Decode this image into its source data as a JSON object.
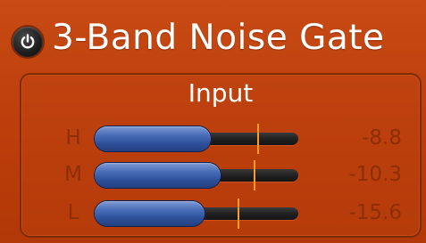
{
  "plugin": {
    "title": "3-Band Noise Gate",
    "power_icon": "power-icon",
    "colors": {
      "background": "#bf420f",
      "meter_fill": "#3b5ea8",
      "peak_marker": "#ff9a22",
      "dim_text": "#8d2e05"
    }
  },
  "input_panel": {
    "title": "Input",
    "meters": [
      {
        "label": "H",
        "value": "-8.8",
        "level_fraction": 0.57,
        "peak_fraction": 0.8
      },
      {
        "label": "M",
        "value": "-10.3",
        "level_fraction": 0.62,
        "peak_fraction": 0.78
      },
      {
        "label": "L",
        "value": "-15.6",
        "level_fraction": 0.54,
        "peak_fraction": 0.7
      }
    ]
  }
}
